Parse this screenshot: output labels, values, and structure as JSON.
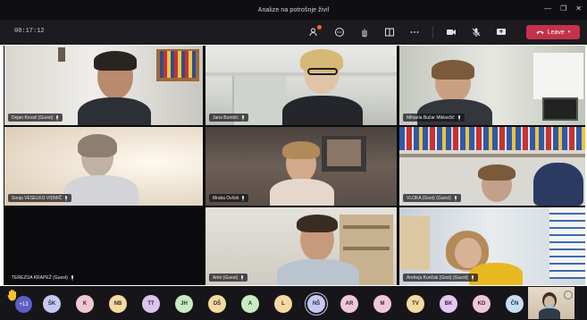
{
  "window": {
    "title": "Analize na potrošnje živil",
    "controls": [
      "—",
      "❐",
      "✕"
    ]
  },
  "toolbar": {
    "timer": "00:17:12",
    "icons": [
      "participants-icon",
      "chat-icon",
      "raise-hand-icon",
      "rooms-icon",
      "more-icon",
      "camera-icon",
      "mic-icon",
      "share-icon"
    ],
    "leave_label": "Leave"
  },
  "colors": {
    "leave": "#c4314b",
    "accent": "#5b5fc7"
  },
  "tiles": [
    {
      "name": "Dejan Kovač (Guest)"
    },
    {
      "name": "Jana Bumbić"
    },
    {
      "name": "Mihaela Bučar Miklavčič"
    },
    {
      "name": "Sonja VESELKO VIDMIČ"
    },
    {
      "name": "Mraka Ovček"
    },
    {
      "name": "VLOKA (Gost) (Guest)"
    },
    {
      "name": "TEREZIJA KRAPEŽ (Guest)"
    },
    {
      "name": "Amir (Guest)"
    },
    {
      "name": "Andreja Kunčak (Gost) (Guest)"
    }
  ],
  "participants_bar": {
    "more_count": "+13",
    "avatars": [
      {
        "initials": "ŠK",
        "color": "#c5c9f2"
      },
      {
        "initials": "K",
        "color": "#f0c8d4"
      },
      {
        "initials": "NB",
        "color": "#f5d9a0"
      },
      {
        "initials": "TT",
        "color": "#dcc4ef"
      },
      {
        "initials": "JH",
        "color": "#c9ebc3"
      },
      {
        "initials": "DŠ",
        "color": "#f5d9a0"
      },
      {
        "initials": "A",
        "color": "#c9ebc3"
      },
      {
        "initials": "L",
        "color": "#f5d9a0"
      },
      {
        "initials": "NŠ",
        "color": "#c5c9f2",
        "active": true
      },
      {
        "initials": "AR",
        "color": "#f0c8d4"
      },
      {
        "initials": "M",
        "color": "#f0c8d4"
      },
      {
        "initials": "TV",
        "color": "#f5d9a0"
      },
      {
        "initials": "BK",
        "color": "#e6c6f2"
      },
      {
        "initials": "KD",
        "color": "#f0c8d4"
      },
      {
        "initials": "ČN",
        "color": "#c5e0f2"
      }
    ]
  }
}
